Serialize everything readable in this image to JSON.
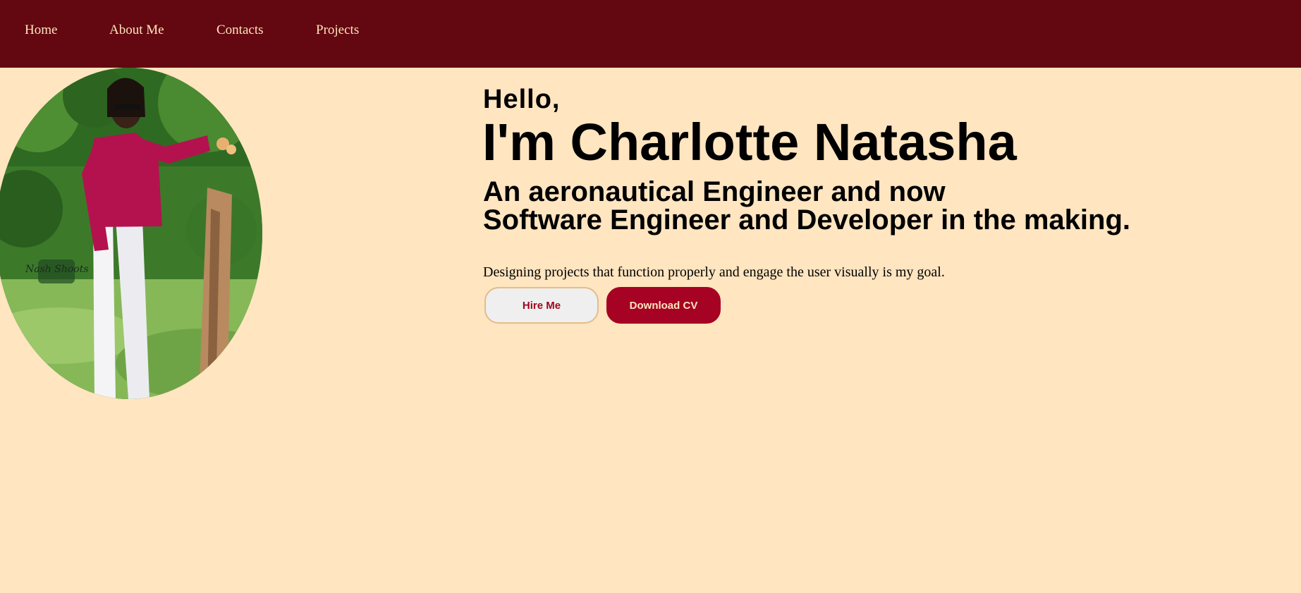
{
  "nav": {
    "items": [
      {
        "label": "Home"
      },
      {
        "label": "About Me"
      },
      {
        "label": "Contacts"
      },
      {
        "label": "Projects"
      }
    ]
  },
  "hero": {
    "greeting": "Hello,",
    "name": "I'm Charlotte Natasha",
    "tagline_line1": "An aeronautical Engineer and now",
    "tagline_line2": "Software Engineer and Developer in the making.",
    "goal": "Designing projects that function properly and engage the user visually is my goal.",
    "hire_label": "Hire Me",
    "cv_label": "Download CV"
  },
  "photo": {
    "watermark": "Nash Shoots"
  },
  "colors": {
    "navbar_bg": "#630710",
    "page_bg": "#ffe5c0",
    "nav_text": "#ffe4c0",
    "accent": "#a60223"
  }
}
